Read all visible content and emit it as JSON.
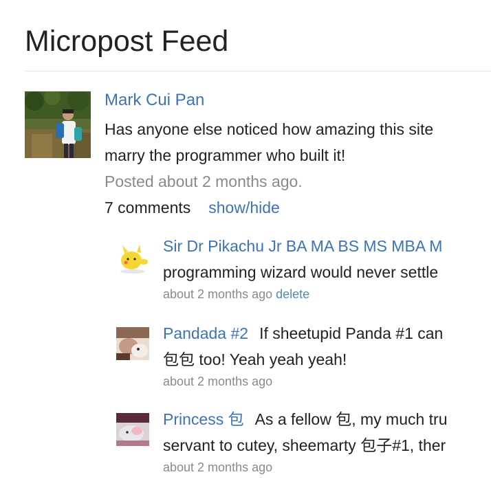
{
  "page": {
    "title": "Micropost Feed"
  },
  "post": {
    "author": "Mark Cui Pan",
    "content_line1": "Has anyone else noticed how amazing this site",
    "content_line2": "marry the programmer who built it!",
    "timestamp": "Posted about 2 months ago.",
    "comment_count": "7 comments",
    "toggle_label": "show/hide"
  },
  "comments": [
    {
      "author": "Sir Dr Pikachu Jr BA MA BS MS MBA M",
      "text_line1": "",
      "text_line2": "programming wizard would never settle",
      "time": "about 2 months ago",
      "delete_label": "delete"
    },
    {
      "author": "Pandada #2",
      "text_line1": "If sheetupid Panda #1 can",
      "text_line2": "包包 too! Yeah yeah yeah!",
      "time": "about 2 months ago"
    },
    {
      "author": "Princess 包",
      "text_line1": "As a fellow 包, my much tru",
      "text_line2": "servant to cutey, sheemarty 包子#1, ther",
      "time": "about 2 months ago"
    }
  ],
  "colors": {
    "link": "#3b73b9",
    "muted": "#8a8a8a",
    "text": "#222222",
    "divider": "#e3e3e3"
  }
}
